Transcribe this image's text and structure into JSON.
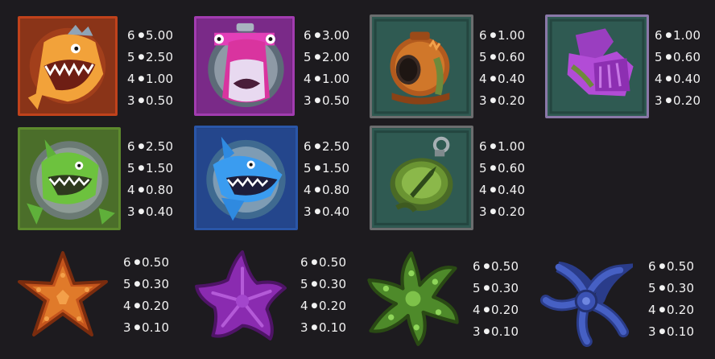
{
  "colors": {
    "background": "#1d1b1f",
    "text": "#f2f2f2"
  },
  "symbols": [
    {
      "name": "orange shark",
      "icon": "orange-shark-icon",
      "frame": "#c0421b",
      "pays": [
        {
          "count": "6",
          "value": "5.00"
        },
        {
          "count": "5",
          "value": "2.50"
        },
        {
          "count": "4",
          "value": "1.00"
        },
        {
          "count": "3",
          "value": "0.50"
        }
      ]
    },
    {
      "name": "pink hammerhead",
      "icon": "pink-hammerhead-icon",
      "frame": "#a23cb0",
      "pays": [
        {
          "count": "6",
          "value": "3.00"
        },
        {
          "count": "5",
          "value": "2.00"
        },
        {
          "count": "4",
          "value": "1.00"
        },
        {
          "count": "3",
          "value": "0.50"
        }
      ]
    },
    {
      "name": "diving helmet",
      "icon": "diving-helmet-icon",
      "frame": "#6b6d6e",
      "pays": [
        {
          "count": "6",
          "value": "1.00"
        },
        {
          "count": "5",
          "value": "0.60"
        },
        {
          "count": "4",
          "value": "0.40"
        },
        {
          "count": "3",
          "value": "0.20"
        }
      ]
    },
    {
      "name": "flippers",
      "icon": "flippers-icon",
      "frame": "#8a78a8",
      "pays": [
        {
          "count": "6",
          "value": "1.00"
        },
        {
          "count": "5",
          "value": "0.60"
        },
        {
          "count": "4",
          "value": "0.40"
        },
        {
          "count": "3",
          "value": "0.20"
        }
      ]
    },
    {
      "name": "green shark",
      "icon": "green-shark-icon",
      "frame": "#5d8a2d",
      "pays": [
        {
          "count": "6",
          "value": "2.50"
        },
        {
          "count": "5",
          "value": "1.50"
        },
        {
          "count": "4",
          "value": "0.80"
        },
        {
          "count": "3",
          "value": "0.40"
        }
      ]
    },
    {
      "name": "blue shark",
      "icon": "blue-shark-icon",
      "frame": "#2a56a8",
      "pays": [
        {
          "count": "6",
          "value": "2.50"
        },
        {
          "count": "5",
          "value": "1.50"
        },
        {
          "count": "4",
          "value": "0.80"
        },
        {
          "count": "3",
          "value": "0.40"
        }
      ]
    },
    {
      "name": "compass",
      "icon": "compass-icon",
      "frame": "#6b6d6e",
      "pays": [
        {
          "count": "6",
          "value": "1.00"
        },
        {
          "count": "5",
          "value": "0.60"
        },
        {
          "count": "4",
          "value": "0.40"
        },
        {
          "count": "3",
          "value": "0.20"
        }
      ]
    },
    {
      "name": "orange starfish",
      "icon": "orange-starfish-icon",
      "frame": "",
      "pays": [
        {
          "count": "6",
          "value": "0.50"
        },
        {
          "count": "5",
          "value": "0.30"
        },
        {
          "count": "4",
          "value": "0.20"
        },
        {
          "count": "3",
          "value": "0.10"
        }
      ]
    },
    {
      "name": "purple starfish",
      "icon": "purple-starfish-icon",
      "frame": "",
      "pays": [
        {
          "count": "6",
          "value": "0.50"
        },
        {
          "count": "5",
          "value": "0.30"
        },
        {
          "count": "4",
          "value": "0.20"
        },
        {
          "count": "3",
          "value": "0.10"
        }
      ]
    },
    {
      "name": "green starfish",
      "icon": "green-starfish-icon",
      "frame": "",
      "pays": [
        {
          "count": "6",
          "value": "0.50"
        },
        {
          "count": "5",
          "value": "0.30"
        },
        {
          "count": "4",
          "value": "0.20"
        },
        {
          "count": "3",
          "value": "0.10"
        }
      ]
    },
    {
      "name": "blue brittle star",
      "icon": "blue-brittle-star-icon",
      "frame": "",
      "pays": [
        {
          "count": "6",
          "value": "0.50"
        },
        {
          "count": "5",
          "value": "0.30"
        },
        {
          "count": "4",
          "value": "0.20"
        },
        {
          "count": "3",
          "value": "0.10"
        }
      ]
    }
  ]
}
